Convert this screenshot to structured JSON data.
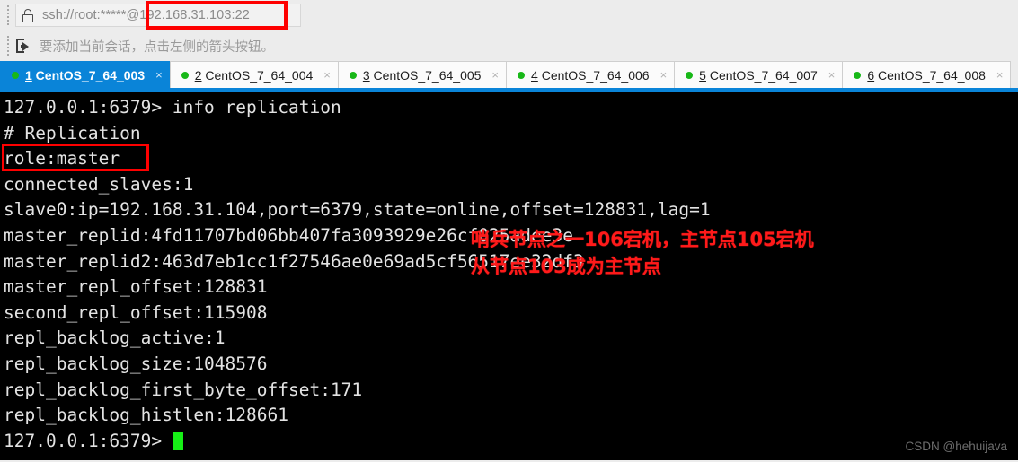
{
  "toolbar": {
    "lock_icon": "lock-icon",
    "url_value": "ssh://root:*****@192.168.31.103:22",
    "hint_icon": "flag-arrow-icon",
    "hint_text": "要添加当前会话，点击左侧的箭头按钮。"
  },
  "tabs": [
    {
      "index": "1",
      "name": " CentOS_7_64_003",
      "active": true,
      "status": "connected",
      "close": "×"
    },
    {
      "index": "2",
      "name": " CentOS_7_64_004",
      "active": false,
      "status": "connected",
      "close": "×"
    },
    {
      "index": "3",
      "name": " CentOS_7_64_005",
      "active": false,
      "status": "connected",
      "close": "×"
    },
    {
      "index": "4",
      "name": " CentOS_7_64_006",
      "active": false,
      "status": "connected",
      "close": "×"
    },
    {
      "index": "5",
      "name": " CentOS_7_64_007",
      "active": false,
      "status": "connected",
      "close": "×"
    },
    {
      "index": "6",
      "name": " CentOS_7_64_008",
      "active": false,
      "status": "connected",
      "close": "×"
    }
  ],
  "terminal": {
    "lines": [
      "127.0.0.1:6379> info replication",
      "# Replication",
      "role:master",
      "connected_slaves:1",
      "slave0:ip=192.168.31.104,port=6379,state=online,offset=128831,lag=1",
      "master_replid:4fd11707bd06bb407fa3093929e26cf025adee3e",
      "master_replid2:463d7eb1cc1f27546ae0e69ad5cf56517ee32df3",
      "master_repl_offset:128831",
      "second_repl_offset:115908",
      "repl_backlog_active:1",
      "repl_backlog_size:1048576",
      "repl_backlog_first_byte_offset:171",
      "repl_backlog_histlen:128661"
    ],
    "prompt": "127.0.0.1:6379> ",
    "cursor": "block-cursor"
  },
  "annotations": {
    "url_highlight": "@192.168.31.103:22",
    "role_highlight": "role:master",
    "note_line1": "哨兵节点之一106宕机，主节点105宕机",
    "note_line2": "从节点103成为主节点"
  },
  "watermark": "CSDN @hehuijava",
  "colors": {
    "accent_blue": "#0a84d8",
    "annotation_red": "#ff1a1a",
    "terminal_bg": "#000000",
    "terminal_fg": "#e3e3e3",
    "cursor_green": "#16f016",
    "tab_dot_green": "#18b818"
  }
}
